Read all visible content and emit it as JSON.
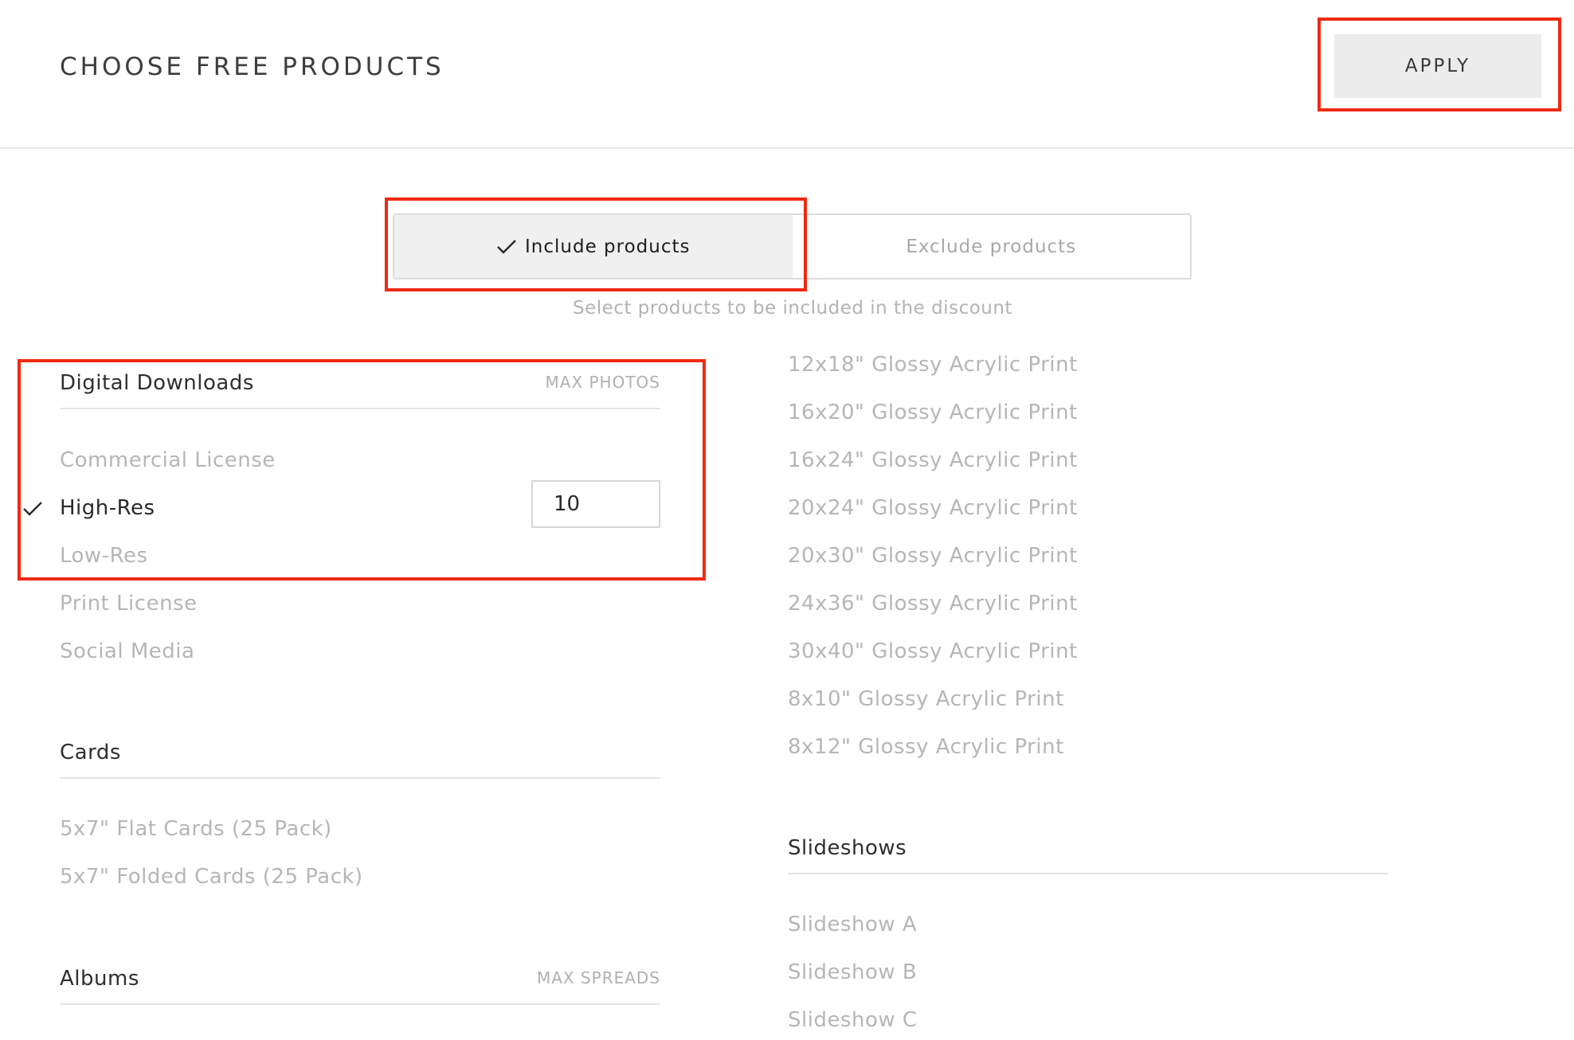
{
  "header": {
    "title": "CHOOSE FREE PRODUCTS",
    "apply_label": "APPLY"
  },
  "mode_toggle": {
    "include_label": "Include products",
    "exclude_label": "Exclude products",
    "selected": "include",
    "helper_text": "Select products to be included in the discount"
  },
  "digital_downloads": {
    "title": "Digital Downloads",
    "max_label": "MAX PHOTOS",
    "items": [
      {
        "label": "Commercial License",
        "selected": false
      },
      {
        "label": "High-Res",
        "selected": true,
        "max_value": "10"
      },
      {
        "label": "Low-Res",
        "selected": false
      },
      {
        "label": "Print License",
        "selected": false
      },
      {
        "label": "Social Media",
        "selected": false
      }
    ]
  },
  "cards": {
    "title": "Cards",
    "items": [
      {
        "label": "5x7\" Flat Cards (25 Pack)"
      },
      {
        "label": "5x7\" Folded Cards (25 Pack)"
      }
    ]
  },
  "albums": {
    "title": "Albums",
    "max_label": "MAX SPREADS"
  },
  "acrylic_prints": {
    "items": [
      {
        "label": "12x18\" Glossy Acrylic Print"
      },
      {
        "label": "16x20\" Glossy Acrylic Print"
      },
      {
        "label": "16x24\" Glossy Acrylic Print"
      },
      {
        "label": "20x24\" Glossy Acrylic Print"
      },
      {
        "label": "20x30\" Glossy Acrylic Print"
      },
      {
        "label": "24x36\" Glossy Acrylic Print"
      },
      {
        "label": "30x40\" Glossy Acrylic Print"
      },
      {
        "label": "8x10\" Glossy Acrylic Print"
      },
      {
        "label": "8x12\" Glossy Acrylic Print"
      }
    ]
  },
  "slideshows": {
    "title": "Slideshows",
    "items": [
      {
        "label": "Slideshow A"
      },
      {
        "label": "Slideshow B"
      },
      {
        "label": "Slideshow C"
      }
    ]
  },
  "colors": {
    "annotation": "#ee2a12",
    "muted_text": "#b6b6b6",
    "active_bg": "#f0f0f0"
  }
}
